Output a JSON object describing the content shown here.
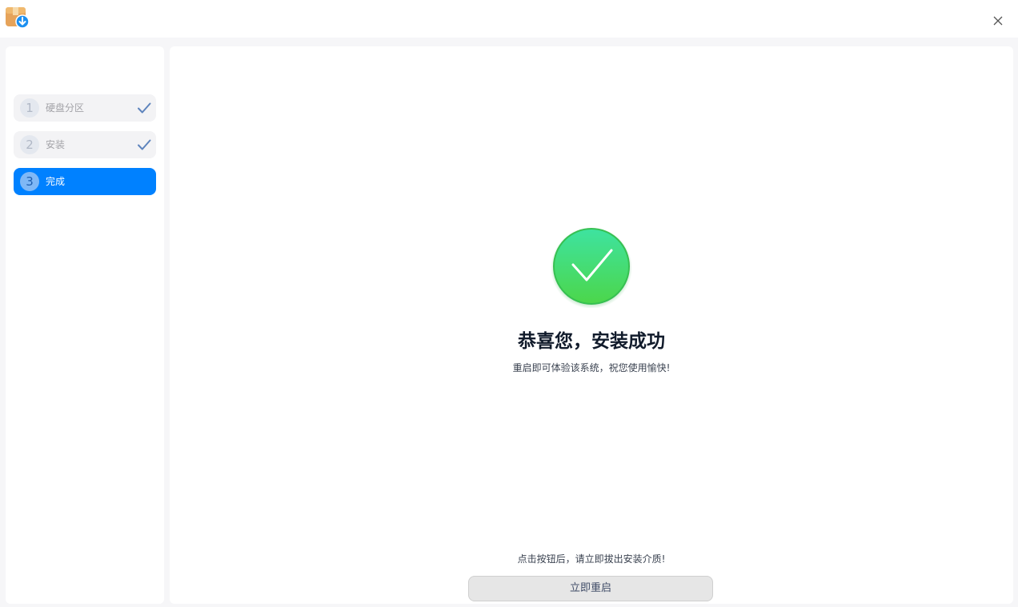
{
  "app": {
    "icon": "package-installer-icon",
    "close_icon": "close-icon"
  },
  "sidebar": {
    "steps": [
      {
        "number": "1",
        "label": "硬盘分区",
        "status": "done"
      },
      {
        "number": "2",
        "label": "安装",
        "status": "done"
      },
      {
        "number": "3",
        "label": "完成",
        "status": "active"
      }
    ]
  },
  "main": {
    "icon": "success-check-icon",
    "title": "恭喜您，安装成功",
    "subtitle": "重启即可体验该系统，祝您使用愉快!",
    "hint": "点击按钮后，请立即拔出安装介质!",
    "restart_label": "立即重启"
  },
  "colors": {
    "accent": "#0081ff",
    "success_top": "#3ee3a0",
    "success_bottom": "#4cd64a",
    "check_done": "#5e84bd"
  }
}
